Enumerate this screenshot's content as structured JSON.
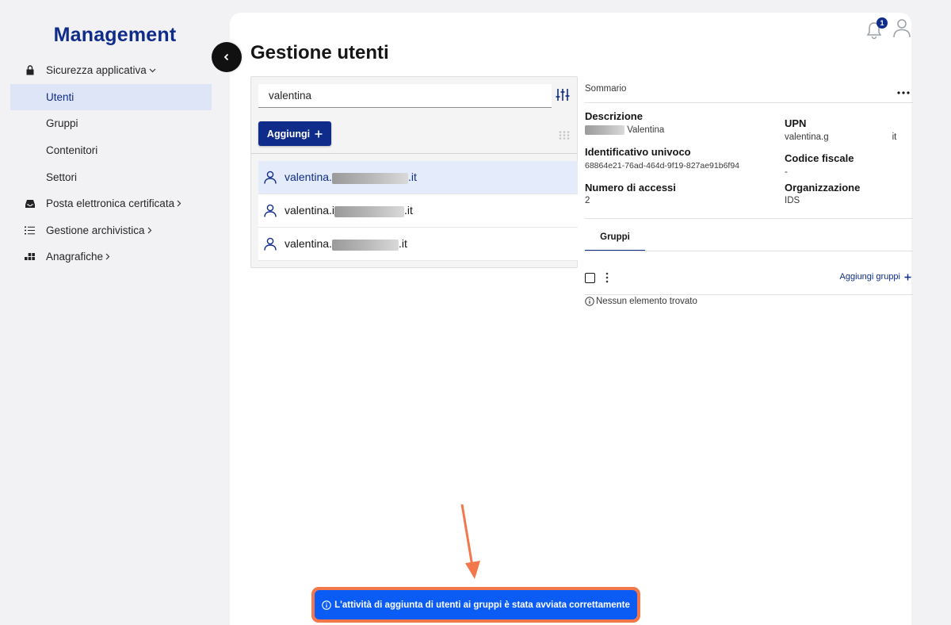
{
  "app": {
    "brand": "Management"
  },
  "sidebar": {
    "items": [
      {
        "label": "Sicurezza applicativa",
        "icon": "lock-icon"
      },
      {
        "label": "Utenti"
      },
      {
        "label": "Gruppi"
      },
      {
        "label": "Contenitori"
      },
      {
        "label": "Settori"
      },
      {
        "label": "Posta elettronica certificata",
        "icon": "inbox-icon"
      },
      {
        "label": "Gestione archivistica",
        "icon": "list-icon"
      },
      {
        "label": "Anagrafiche",
        "icon": "apps-icon"
      }
    ]
  },
  "header": {
    "title": "Gestione utenti",
    "notification_count": "1"
  },
  "search": {
    "value": "valentina"
  },
  "toolbar": {
    "add_label": "Aggiungi"
  },
  "users": [
    {
      "prefix": "valentina.",
      "suffix": ".it"
    },
    {
      "prefix": "valentina.i",
      "suffix": ".it"
    },
    {
      "prefix": "valentina.",
      "suffix": ".it"
    }
  ],
  "details": {
    "sommario": "Sommario",
    "descrizione_label": "Descrizione",
    "descrizione_value": "Valentina",
    "upn_label": "UPN",
    "upn_prefix": "valentina.g",
    "upn_suffix": "it",
    "id_label": "Identificativo univoco",
    "id_value": "68864e21-76ad-464d-9f19-827ae91b6f94",
    "cf_label": "Codice fiscale",
    "cf_value": "-",
    "accessi_label": "Numero di accessi",
    "accessi_value": "2",
    "org_label": "Organizzazione",
    "org_value": "IDS",
    "tab_label": "Gruppi",
    "add_groups_label": "Aggiungi gruppi",
    "empty_message": "Nessun elemento trovato"
  },
  "toast": {
    "message": "L'attività di aggiunta di utenti ai gruppi è stata avviata correttamente"
  },
  "colors": {
    "primary": "#0f2c8a",
    "toast": "#0a5cf5",
    "annotation": "#f2784b"
  }
}
